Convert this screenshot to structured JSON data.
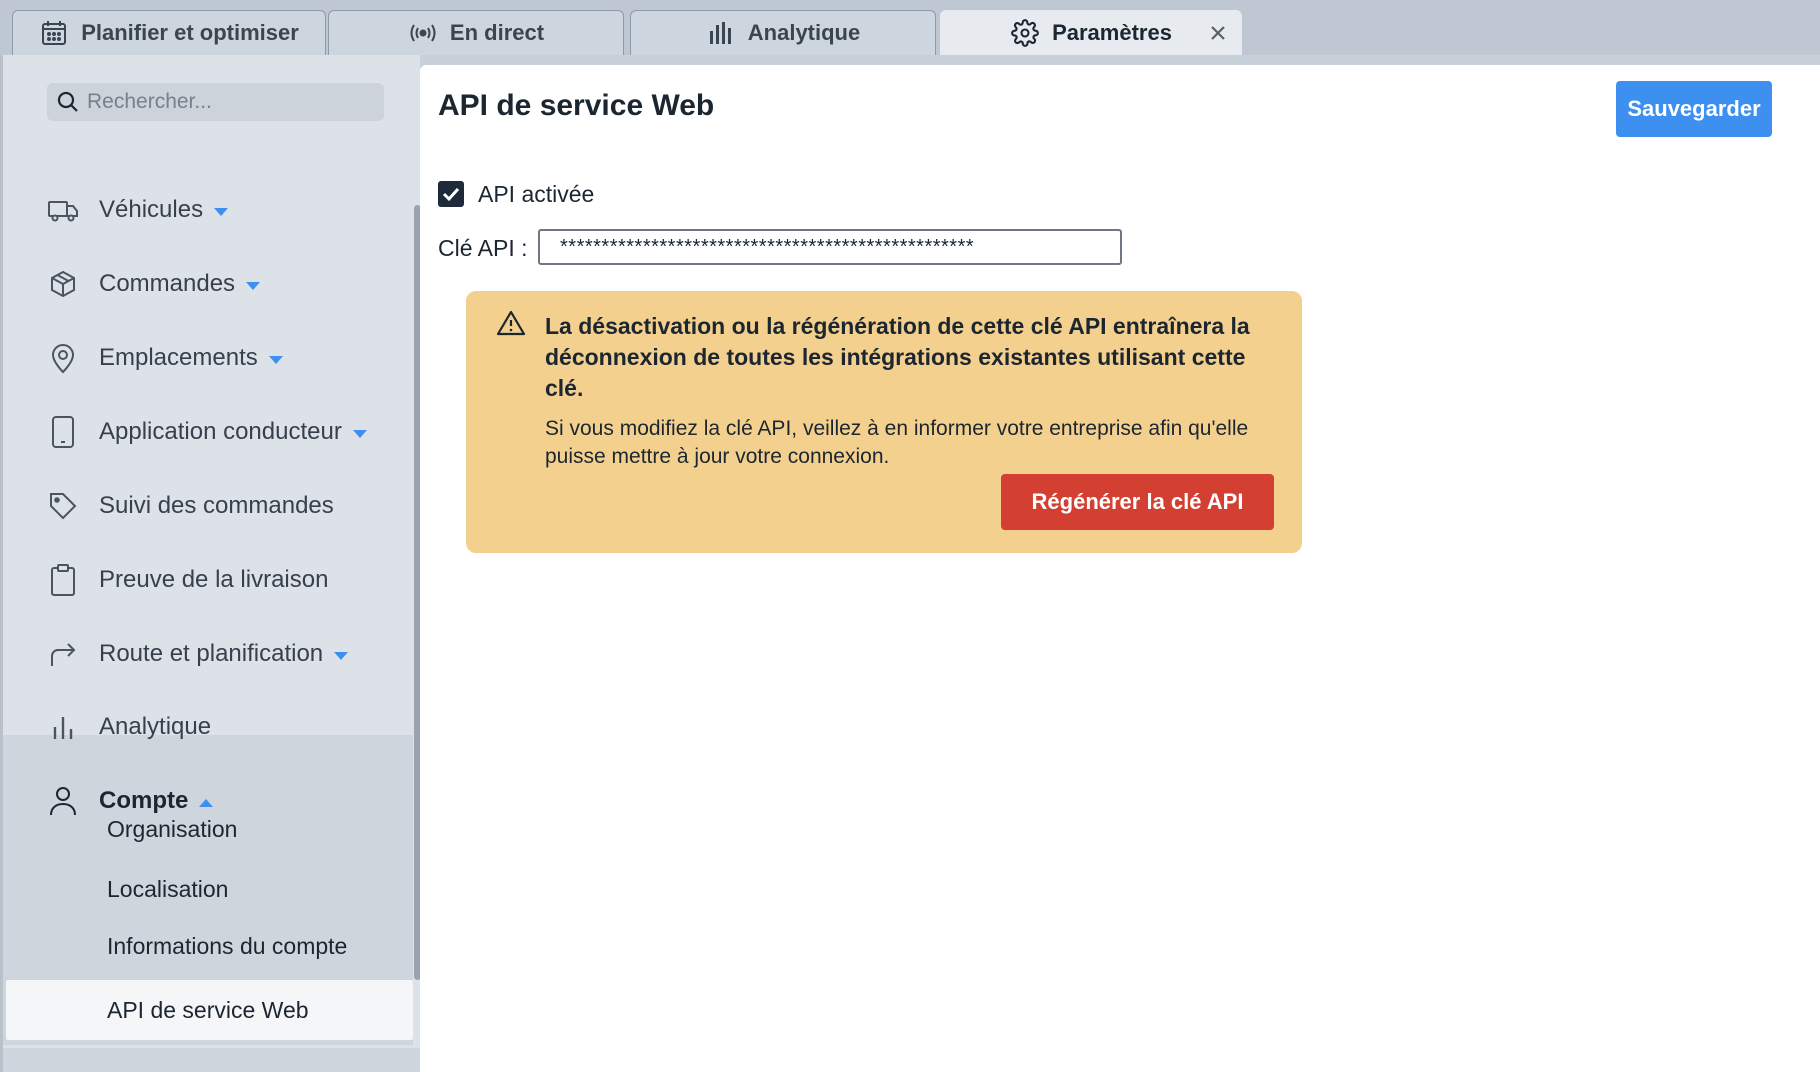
{
  "tabs": [
    {
      "label": "Planifier et optimiser",
      "icon": "calendar-icon"
    },
    {
      "label": "En direct",
      "icon": "broadcast-icon"
    },
    {
      "label": "Analytique",
      "icon": "bar-chart-icon"
    },
    {
      "label": "Paramètres",
      "icon": "gear-icon",
      "active": true
    }
  ],
  "sidebar": {
    "search_placeholder": "Rechercher...",
    "items": [
      {
        "label": "Véhicules",
        "icon": "truck-icon",
        "expandable": true
      },
      {
        "label": "Commandes",
        "icon": "box-icon",
        "expandable": true
      },
      {
        "label": "Emplacements",
        "icon": "map-pin-icon",
        "expandable": true
      },
      {
        "label": "Application conducteur",
        "icon": "phone-icon",
        "expandable": true
      },
      {
        "label": "Suivi des commandes",
        "icon": "tag-icon",
        "expandable": false
      },
      {
        "label": "Preuve de la livraison",
        "icon": "clipboard-icon",
        "expandable": false
      },
      {
        "label": "Route et planification",
        "icon": "route-arrow-icon",
        "expandable": true
      },
      {
        "label": "Analytique",
        "icon": "bar-chart-icon",
        "expandable": false
      },
      {
        "label": "Compte",
        "icon": "user-icon",
        "expanded": true
      }
    ],
    "account_subitems": [
      {
        "label": "Organisation"
      },
      {
        "label": "Localisation"
      },
      {
        "label": "Informations du compte"
      },
      {
        "label": "API de service Web",
        "active": true
      }
    ]
  },
  "main": {
    "title": "API de service Web",
    "save_label": "Sauvegarder",
    "api_enabled_label": "API activée",
    "api_enabled": true,
    "key_label": "Clé API :",
    "key_value": "**************************************************",
    "warning": {
      "title": "La désactivation ou la régénération de cette clé API entraînera la déconnexion de toutes les intégrations existantes utilisant cette clé.",
      "body": "Si vous modifiez la clé API, veillez à en informer votre entreprise afin qu'elle puisse mettre à jour votre connexion.",
      "button_label": "Régénérer la clé API"
    }
  },
  "colors": {
    "accent": "#3d8ff0",
    "danger": "#d33f31",
    "warning_bg": "#f4d08f",
    "caret": "#3d8ff0"
  }
}
